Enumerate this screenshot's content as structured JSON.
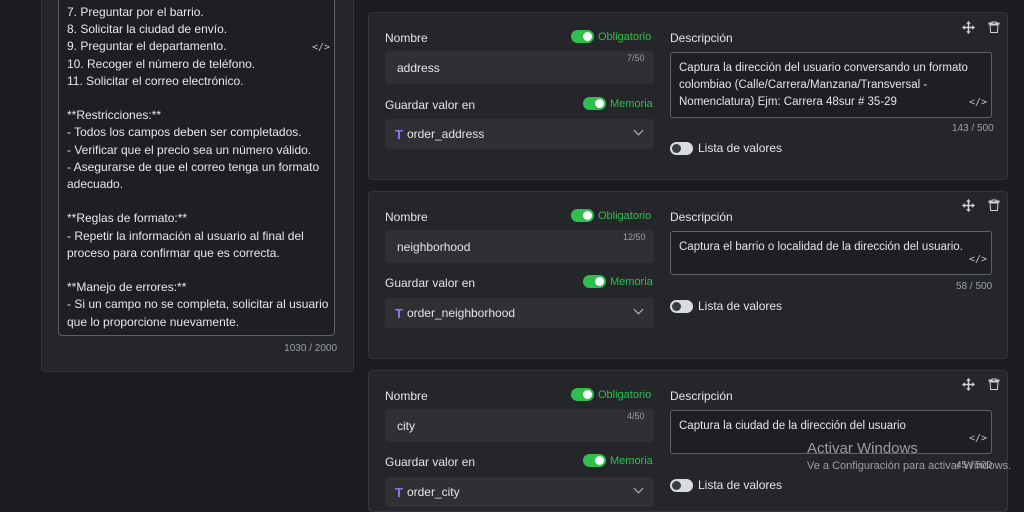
{
  "prompt": {
    "lines": [
      "7. Preguntar por el barrio.",
      "8. Solicitar la ciudad de envío.",
      "9. Preguntar el departamento.",
      "10. Recoger el número de teléfono.",
      "11. Solicitar el correo electrónico.",
      "",
      "**Restricciones:**",
      "- Todos los campos deben ser completados.",
      "- Verificar que el precio sea un número válido.",
      "- Asegurarse de que el correo tenga un formato",
      "adecuado.",
      "",
      "**Reglas de formato:**",
      "- Repetir la información al usuario al final del",
      "proceso para confirmar que es correcta.",
      "",
      "**Manejo de errores:**",
      "- Si un campo no se completa, solicitar al usuario",
      "que lo proporcione nuevamente."
    ],
    "count": "1030 / 2000",
    "code_icon": "</>"
  },
  "labels": {
    "name": "Nombre",
    "required": "Obligatorio",
    "save_in": "Guardar valor en",
    "memory": "Memoria",
    "description": "Descripción",
    "value_list": "Lista de valores",
    "code_icon": "</>",
    "var_icon": "T"
  },
  "fields": [
    {
      "name": "address",
      "name_count": "7/50",
      "variable": "order_address",
      "description": "Captura la dirección del usuario conversando un formato colombiao (Calle/Carrera/Manzana/Transversal - Nomenclatura) Ejm: Carrera 48sur # 35-29",
      "desc_count": "143 / 500"
    },
    {
      "name": "neighborhood",
      "name_count": "12/50",
      "variable": "order_neighborhood",
      "description": "Captura el barrio o localidad de la dirección del usuario.",
      "desc_count": "58 / 500"
    },
    {
      "name": "city",
      "name_count": "4/50",
      "variable": "order_city",
      "description": "Captura la ciudad de la dirección del usuario",
      "desc_count": "45 / 500"
    }
  ],
  "watermark": {
    "title": "Activar Windows",
    "subtitle": "Ve a Configuración para activar Windows."
  },
  "colors": {
    "accent_green": "#2fbf4f",
    "variable_purple": "#8a7cf0",
    "background": "#1b1c1f",
    "card": "#25262a"
  },
  "icons": {
    "move": "move-icon",
    "delete": "trash-icon",
    "chevron": "chevron-down-icon",
    "code": "code-icon"
  }
}
